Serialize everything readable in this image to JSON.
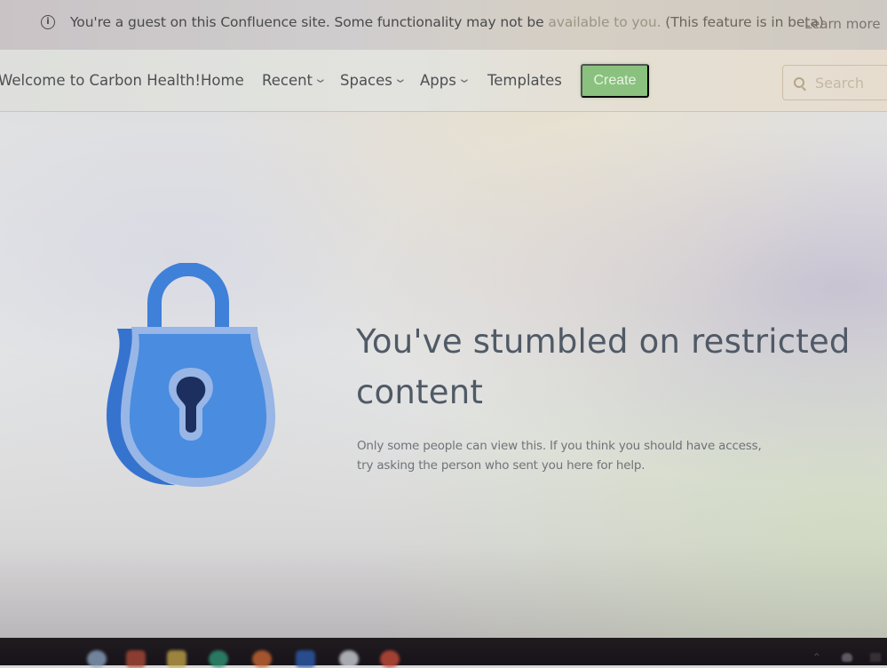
{
  "banner": {
    "message_part1": "You're a guest on this Confluence site. Some functionality may not be ",
    "message_part2": "available to you. ",
    "message_part3": "(This feature is in beta)",
    "learn_more": "Learn more",
    "icon": "info-icon"
  },
  "header": {
    "site_title": "Welcome to Carbon Health!",
    "nav": [
      {
        "label": "Home",
        "dropdown": false
      },
      {
        "label": "Recent",
        "dropdown": true
      },
      {
        "label": "Spaces",
        "dropdown": true
      },
      {
        "label": "Apps",
        "dropdown": true
      },
      {
        "label": "Templates",
        "dropdown": false
      }
    ],
    "create_label": "Create",
    "search_placeholder": "Search",
    "chevron_glyph": "⌄",
    "create_color": "#8ac17f"
  },
  "main": {
    "illustration": "padlock-icon",
    "headline": "You've stumbled on restricted content",
    "subtext_line1": "Only some people can view this. If you think you should have access,",
    "subtext_line2": "try asking the person who sent you here for help.",
    "lock_colors": {
      "dark": "#3a7bd5",
      "light": "#8fb0e3",
      "body": "#4a8ce0",
      "keyhole": "#1d2f5e"
    }
  },
  "taskbar": {
    "icons": [
      "browser-icon",
      "app-icon",
      "file-explorer-icon",
      "edge-icon",
      "firefox-icon",
      "word-icon",
      "notification-app-icon",
      "chrome-icon"
    ],
    "tray": [
      "tray-chevron-icon",
      "tray-cloud-icon",
      "tray-app-icon"
    ]
  }
}
